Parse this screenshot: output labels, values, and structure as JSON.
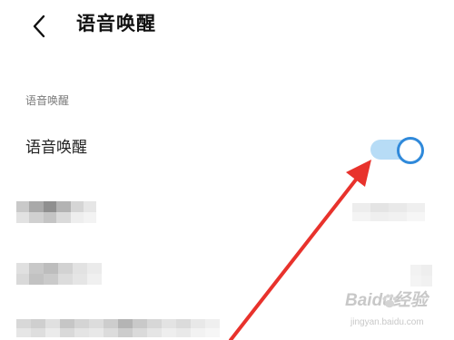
{
  "header": {
    "back_icon": "chevron-left-icon",
    "title": "语音唤醒"
  },
  "section": {
    "header": "语音唤醒"
  },
  "setting": {
    "label": "语音唤醒",
    "toggle_state": "on",
    "toggle_track_color": "#b7dcf6",
    "toggle_knob_border_color": "#2f89da"
  },
  "annotation": {
    "arrow_color": "#e8322c"
  },
  "watermark": {
    "logo_text": "Baidu经验",
    "url": "jingyan.baidu.com"
  }
}
